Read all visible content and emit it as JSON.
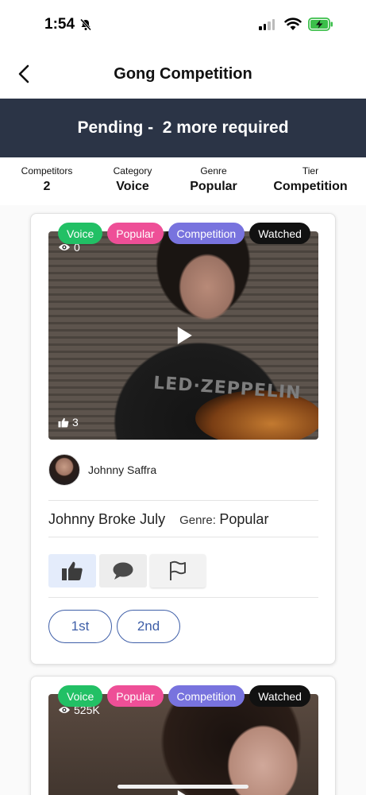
{
  "status_bar": {
    "time": "1:54"
  },
  "nav": {
    "title": "Gong Competition"
  },
  "banner": {
    "text": "Pending -  2 more required"
  },
  "meta": [
    {
      "label": "Competitors",
      "value": "2"
    },
    {
      "label": "Category",
      "value": "Voice"
    },
    {
      "label": "Genre",
      "value": "Popular"
    },
    {
      "label": "Tier",
      "value": "Competition"
    }
  ],
  "cards": [
    {
      "badges": [
        "Voice",
        "Popular",
        "Competition",
        "Watched"
      ],
      "views": "0",
      "likes": "3",
      "author": "Johnny Saffra",
      "song_title": "Johnny Broke July",
      "genre_label": "Genre:",
      "genre_value": "Popular",
      "rank_buttons": [
        "1st",
        "2nd"
      ]
    },
    {
      "badges": [
        "Voice",
        "Popular",
        "Competition",
        "Watched"
      ],
      "views": "525K"
    }
  ],
  "colors": {
    "banner_bg": "#2b3446",
    "voice": "#22c065",
    "popular": "#ee4f97",
    "competition": "#7873de",
    "watched": "#111111",
    "rank_accent": "#3f5fa8"
  },
  "icons": [
    "back-chevron-icon",
    "silent-bell-icon",
    "signal-icon",
    "wifi-icon",
    "battery-charging-icon",
    "eye-icon",
    "thumbs-up-icon",
    "play-icon",
    "comment-icon",
    "flag-icon"
  ]
}
